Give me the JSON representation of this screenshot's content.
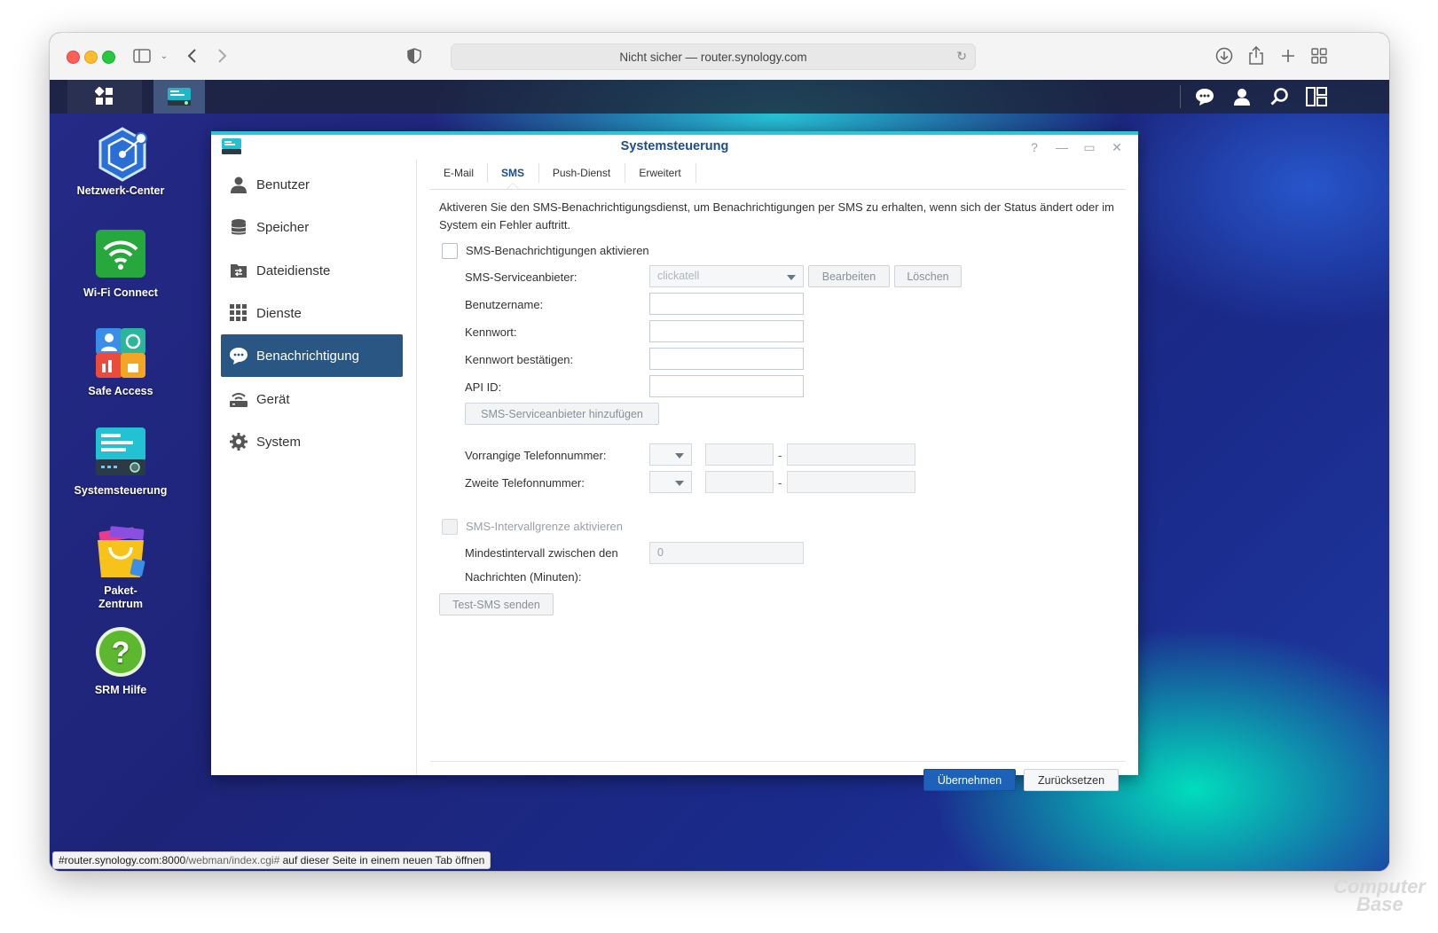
{
  "browser": {
    "url_text": "Nicht sicher — router.synology.com",
    "status_url": "#router.synology.com:8000",
    "status_path": "/webman/index.cgi#",
    "status_suffix": " auf dieser Seite in einem neuen Tab öffnen"
  },
  "desktop": {
    "icons": [
      {
        "label": "Netzwerk-Center",
        "icon": "network-center-icon"
      },
      {
        "label": "Wi-Fi Connect",
        "icon": "wifi-icon"
      },
      {
        "label": "Safe Access",
        "icon": "safe-access-icon"
      },
      {
        "label": "Systemsteuerung",
        "icon": "control-panel-icon"
      },
      {
        "label": "Paket-\nZentrum",
        "label_line1": "Paket-",
        "label_line2": "Zentrum",
        "icon": "package-center-icon"
      },
      {
        "label": "SRM Hilfe",
        "icon": "help-icon"
      }
    ]
  },
  "window": {
    "title": "Systemsteuerung",
    "controls": {
      "help": "?",
      "minimize": "—",
      "maximize": "▭",
      "close": "✕"
    },
    "sidebar": [
      {
        "label": "Benutzer",
        "icon": "user-icon"
      },
      {
        "label": "Speicher",
        "icon": "storage-icon"
      },
      {
        "label": "Dateidienste",
        "icon": "file-services-icon"
      },
      {
        "label": "Dienste",
        "icon": "services-grid-icon"
      },
      {
        "label": "Benachrichtigung",
        "icon": "notification-icon",
        "active": true
      },
      {
        "label": "Gerät",
        "icon": "device-icon"
      },
      {
        "label": "System",
        "icon": "system-gear-icon"
      }
    ],
    "tabs": [
      {
        "label": "E-Mail"
      },
      {
        "label": "SMS",
        "active": true
      },
      {
        "label": "Push-Dienst"
      },
      {
        "label": "Erweitert"
      }
    ],
    "sms": {
      "description": "Aktiveren Sie den SMS-Benachrichtigungsdienst, um Benachrichtigungen per SMS zu erhalten, wenn sich der Status ändert oder im System ein Fehler auftritt.",
      "enable_label": "SMS-Benachrichtigungen aktivieren",
      "provider_label": "SMS-Serviceanbieter:",
      "provider_value": "clickatell",
      "edit_button": "Bearbeiten",
      "delete_button": "Löschen",
      "username_label": "Benutzername:",
      "password_label": "Kennwort:",
      "confirm_password_label": "Kennwort bestätigen:",
      "api_id_label": "API ID:",
      "add_provider_button": "SMS-Serviceanbieter hinzufügen",
      "primary_phone_label": "Vorrangige Telefonnummer:",
      "secondary_phone_label": "Zweite Telefonnummer:",
      "phone_dash": "-",
      "interval_enable_label": "SMS-Intervallgrenze aktivieren",
      "interval_label_line1": "Mindestintervall zwischen den",
      "interval_label_line2": "Nachrichten (Minuten):",
      "interval_value": "0",
      "test_button": "Test-SMS senden"
    },
    "footer": {
      "apply_button": "Übernehmen",
      "reset_button": "Zurücksetzen"
    }
  },
  "watermark": {
    "line1": "Computer",
    "line2": "Base"
  },
  "colors": {
    "active_sidebar": "#2a5684",
    "primary_button": "#1d62b8",
    "title": "#1f4d8a"
  }
}
